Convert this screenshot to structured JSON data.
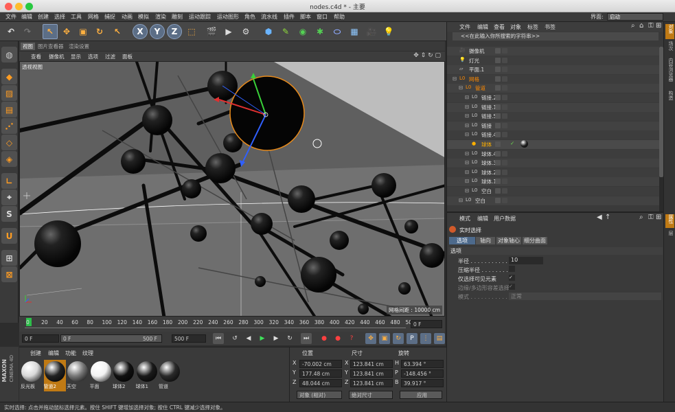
{
  "window": {
    "title": "nodes.c4d * - 主要"
  },
  "menubar": {
    "items": [
      "文件",
      "编辑",
      "创建",
      "选择",
      "工具",
      "网格",
      "捕捉",
      "动画",
      "模拟",
      "渲染",
      "雕刻",
      "运动跟踪",
      "运动图形",
      "角色",
      "流水线",
      "插件",
      "脚本",
      "窗口",
      "帮助"
    ],
    "interface_label": "界面:",
    "interface_value": "启动"
  },
  "viewport_tabs": [
    "视图",
    "图片查看器",
    "渲染设置"
  ],
  "viewport_menu": [
    "查看",
    "摄像机",
    "显示",
    "选项",
    "过滤",
    "面板"
  ],
  "viewport": {
    "label": "透视视图",
    "grid_spacing": "网格间距 : 10000 cm"
  },
  "timeline": {
    "ticks": [
      "0",
      "20",
      "40",
      "60",
      "80",
      "100",
      "120",
      "140",
      "160",
      "180",
      "200",
      "220",
      "240",
      "260",
      "280",
      "300",
      "320",
      "340",
      "360",
      "380",
      "400",
      "420",
      "440",
      "460",
      "480",
      "500"
    ],
    "end_field": "0 F"
  },
  "transport": {
    "current": "0 F",
    "range_start": "0 F",
    "range_end": "500 F",
    "max": "500 F"
  },
  "materials": {
    "menu": [
      "创建",
      "编辑",
      "功能",
      "纹理"
    ],
    "items": [
      {
        "name": "反光板",
        "color": "#d8d8d8"
      },
      {
        "name": "管道2",
        "color": "#222222"
      },
      {
        "name": "天空",
        "color": "#777777"
      },
      {
        "name": "平面",
        "color": "#f2f2f2"
      },
      {
        "name": "球体2",
        "color": "#111111"
      },
      {
        "name": "球体1",
        "color": "#1a1a1a"
      },
      {
        "name": "管道",
        "color": "#2a2a2a"
      }
    ],
    "selected": "管道2"
  },
  "coords": {
    "headers": [
      "位置",
      "尺寸",
      "旋转"
    ],
    "rows": [
      {
        "axis": "X",
        "pos": "-70.002 cm",
        "size": "123.841 cm",
        "rot_label": "H",
        "rot": "63.394 °"
      },
      {
        "axis": "Y",
        "pos": "177.48 cm",
        "size": "123.841 cm",
        "rot_label": "P",
        "rot": "-148.456 °"
      },
      {
        "axis": "Z",
        "pos": "48.044 cm",
        "size": "123.841 cm",
        "rot_label": "B",
        "rot": "39.917 °"
      }
    ],
    "mode": "对象 (相对)",
    "size_mode": "绝对尺寸",
    "apply": "应用"
  },
  "objmgr": {
    "menu": [
      "文件",
      "编辑",
      "查看",
      "对象",
      "标签",
      "书签"
    ],
    "search_placeholder": "<<在此输入你所搜索的字符串>>",
    "rows": [
      {
        "name": "摄像机",
        "indent": 0,
        "icon": "camera-icon"
      },
      {
        "name": "灯光",
        "indent": 0,
        "icon": "light-icon"
      },
      {
        "name": "平面.1",
        "indent": 0,
        "icon": "plane-icon"
      },
      {
        "name": "网格",
        "indent": 0,
        "icon": "null-icon",
        "color": "#ff8a00"
      },
      {
        "name": "管道",
        "indent": 1,
        "icon": "null-icon",
        "color": "#ff8a00"
      },
      {
        "name": "链接.2",
        "indent": 2,
        "icon": "null-icon"
      },
      {
        "name": "链接.1",
        "indent": 2,
        "icon": "null-icon"
      },
      {
        "name": "链接.5",
        "indent": 2,
        "icon": "null-icon"
      },
      {
        "name": "链接",
        "indent": 2,
        "icon": "null-icon"
      },
      {
        "name": "链接.4",
        "indent": 2,
        "icon": "null-icon"
      },
      {
        "name": "球体",
        "indent": 2,
        "icon": "sphere-icon",
        "color": "#ffb000"
      },
      {
        "name": "球体.4",
        "indent": 2,
        "icon": "null-icon"
      },
      {
        "name": "球体.3",
        "indent": 2,
        "icon": "null-icon"
      },
      {
        "name": "球体.2",
        "indent": 2,
        "icon": "null-icon"
      },
      {
        "name": "球体.1",
        "indent": 2,
        "icon": "null-icon"
      },
      {
        "name": "空白",
        "indent": 2,
        "icon": "null-icon"
      },
      {
        "name": "空白",
        "indent": 1,
        "icon": "null-icon"
      }
    ]
  },
  "attrmgr": {
    "menu": [
      "模式",
      "编辑",
      "用户数据"
    ],
    "tool": "实时选择",
    "tabs": [
      "选项",
      "轴向",
      "对象轴心",
      "细分曲面"
    ],
    "section": "选项",
    "fields": [
      {
        "label": "半径 . . . . . . . . . . . .",
        "value": "10"
      },
      {
        "label": "压缩半径 . . . . . . . . .",
        "value": ""
      },
      {
        "label": "仅选择可见元素",
        "value": "✓"
      },
      {
        "label": "边缘/多边形容差选择",
        "value": "✓"
      },
      {
        "label": "模式 . . . . . . . . . . . .",
        "value": "正常"
      }
    ]
  },
  "sidetabs": [
    "对象",
    "场次",
    "内容浏览器",
    "构造"
  ],
  "sidetabs2": [
    "属性",
    "层"
  ],
  "statusbar": "实时选择: 点击并拖动鼠标选择元素。按住 SHIFT 键增加选择对象; 按住 CTRL 键减少选择对象。",
  "brand": {
    "top": "MAXON",
    "bottom": "CINEMA 4D"
  },
  "colors": {
    "accent": "#ff9c22",
    "selection": "#4d6a8c",
    "bg": "#3a3a3a"
  }
}
